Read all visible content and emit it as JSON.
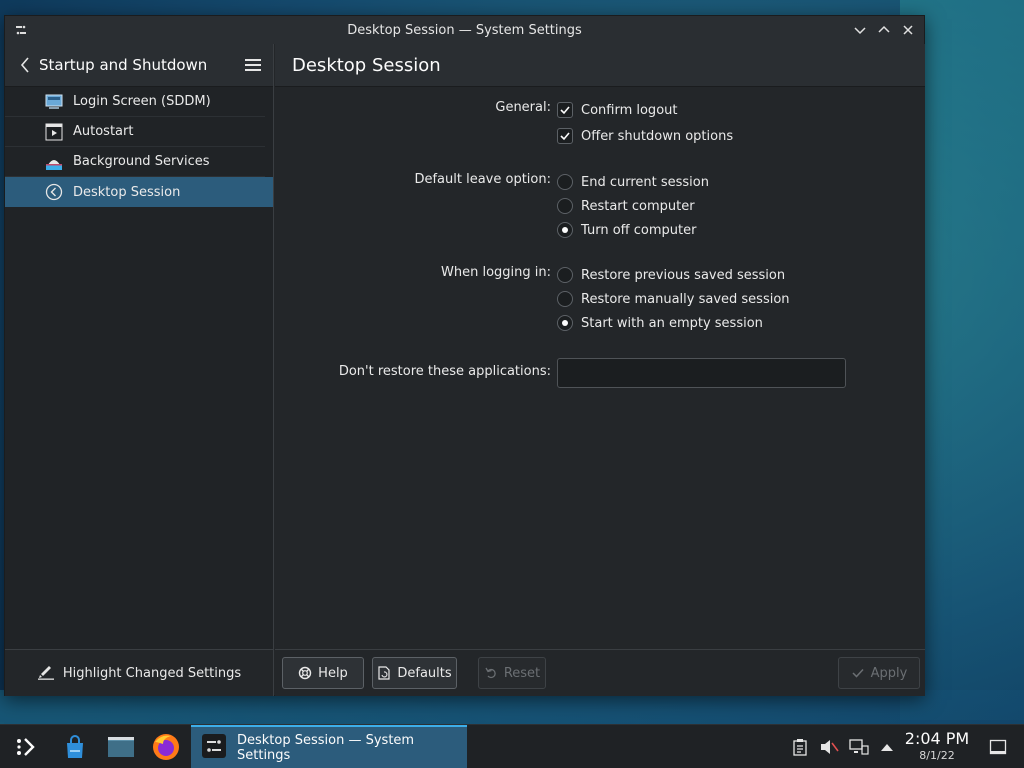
{
  "window": {
    "title": "Desktop Session — System Settings"
  },
  "sidebar": {
    "header_title": "Startup and Shutdown",
    "items": [
      {
        "label": "Login Screen (SDDM)",
        "icon": "monitor-icon"
      },
      {
        "label": "Autostart",
        "icon": "autostart-icon"
      },
      {
        "label": "Background Services",
        "icon": "services-icon"
      },
      {
        "label": "Desktop Session",
        "icon": "session-icon",
        "active": true
      }
    ],
    "footer_label": "Highlight Changed Settings"
  },
  "main": {
    "page_title": "Desktop Session",
    "general": {
      "label": "General:",
      "options": [
        {
          "label": "Confirm logout",
          "checked": true
        },
        {
          "label": "Offer shutdown options",
          "checked": true
        }
      ]
    },
    "default_leave": {
      "label": "Default leave option:",
      "options": [
        {
          "label": "End current session",
          "selected": false
        },
        {
          "label": "Restart computer",
          "selected": false
        },
        {
          "label": "Turn off computer",
          "selected": true
        }
      ]
    },
    "logging_in": {
      "label": "When logging in:",
      "options": [
        {
          "label": "Restore previous saved session",
          "selected": false
        },
        {
          "label": "Restore manually saved session",
          "selected": false
        },
        {
          "label": "Start with an empty session",
          "selected": true
        }
      ]
    },
    "exclude": {
      "label": "Don't restore these applications:",
      "value": ""
    },
    "buttons": {
      "help": "Help",
      "defaults": "Defaults",
      "reset": "Reset",
      "apply": "Apply"
    }
  },
  "taskbar": {
    "task_label": "Desktop Session — System Settings",
    "time": "2:04 PM",
    "date": "8/1/22"
  },
  "colors": {
    "accent": "#3daee9",
    "selection": "#2c5c7c",
    "window_bg": "#232629"
  }
}
